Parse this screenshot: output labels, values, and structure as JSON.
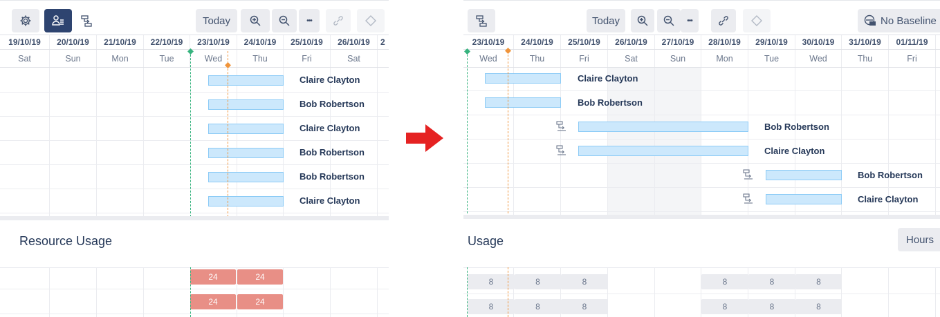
{
  "left": {
    "toolbar": {
      "settings_icon": "gear-icon",
      "resource_view_icon": "resource-list-icon",
      "dependency_icon": "dependency-icon",
      "today_label": "Today",
      "zoom_in_icon": "zoom-in-icon",
      "zoom_out_icon": "zoom-out-icon",
      "more_label": "•••",
      "link_icon": "link-icon",
      "milestone_icon": "diamond-icon"
    },
    "dates": [
      "19/10/19",
      "20/10/19",
      "21/10/19",
      "22/10/19",
      "23/10/19",
      "24/10/19",
      "25/10/19",
      "26/10/19",
      "2"
    ],
    "days": [
      "Sat",
      "Sun",
      "Mon",
      "Tue",
      "Wed",
      "Thu",
      "Fri",
      "Sat",
      ""
    ],
    "tasks": [
      "Claire Clayton",
      "Bob Robertson",
      "Claire Clayton",
      "Bob Robertson",
      "Bob Robertson",
      "Claire Clayton"
    ],
    "usage_title": "Resource Usage",
    "usage_rows": [
      [
        "24",
        "24"
      ],
      [
        "24",
        "24"
      ]
    ],
    "colors": {
      "overload": "#e88f86",
      "today": "#36b37e",
      "now": "#f0943a",
      "bar": "#cce8fc"
    }
  },
  "right": {
    "toolbar": {
      "dependency_icon": "dependency-icon",
      "today_label": "Today",
      "zoom_in_icon": "zoom-in-icon",
      "zoom_out_icon": "zoom-out-icon",
      "more_label": "•••",
      "link_icon": "link-icon",
      "milestone_icon": "diamond-icon",
      "baseline_icon": "baseline-icon",
      "baseline_label": "No Baseline"
    },
    "dates": [
      "23/10/19",
      "24/10/19",
      "25/10/19",
      "26/10/19",
      "27/10/19",
      "28/10/19",
      "29/10/19",
      "30/10/19",
      "31/10/19",
      "01/11/19"
    ],
    "days": [
      "Wed",
      "Thu",
      "Fri",
      "Sat",
      "Sun",
      "Mon",
      "Tue",
      "Wed",
      "Thu",
      "Fri"
    ],
    "tasks": [
      "Claire Clayton",
      "Bob Robertson",
      "Bob Robertson",
      "Claire Clayton",
      "Bob Robertson",
      "Claire Clayton"
    ],
    "usage_title": "Usage",
    "hours_label": "Hours",
    "usage_rows": [
      [
        "8",
        "8",
        "8",
        "",
        "",
        "8",
        "8",
        "8"
      ],
      [
        "8",
        "8",
        "8",
        "",
        "",
        "8",
        "8",
        "8"
      ]
    ]
  },
  "transition_arrow_icon": "right-arrow-icon"
}
